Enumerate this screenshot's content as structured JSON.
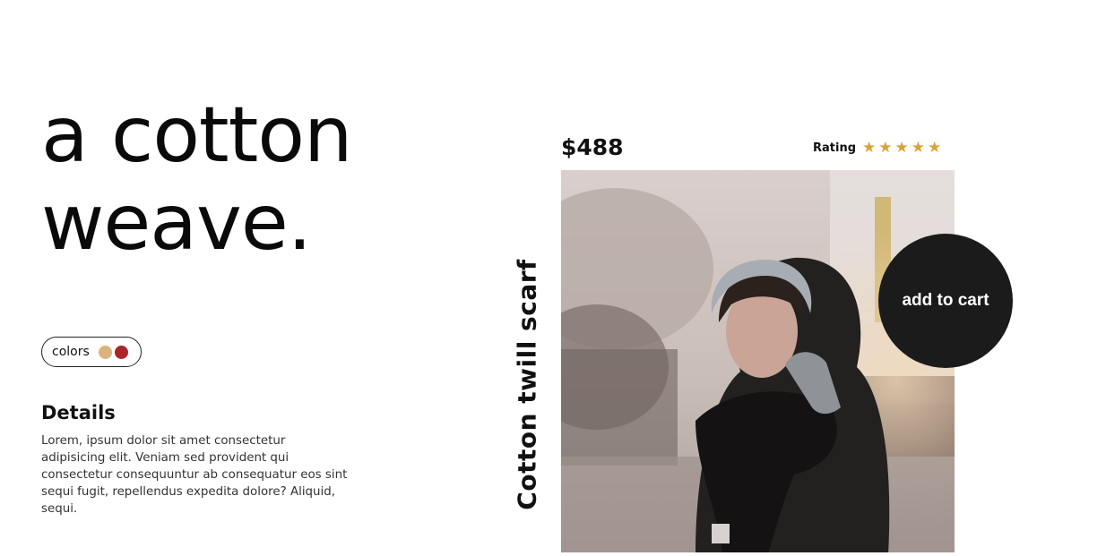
{
  "hero": {
    "line1": "a cotton",
    "line2": "weave."
  },
  "colors": {
    "label": "colors",
    "swatches": [
      {
        "name": "tan",
        "color": "#dcb27f"
      },
      {
        "name": "red",
        "color": "#a8262c"
      }
    ]
  },
  "details": {
    "title": "Details",
    "text": "Lorem, ipsum dolor sit amet consectetur adipisicing elit. Veniam sed provident qui consectetur consequuntur ab consequatur eos sint sequi fugit, repellendus expedita dolore? Aliquid, sequi."
  },
  "product": {
    "name": "Cotton twill scarf",
    "price": "$488",
    "rating_label": "Rating",
    "rating_stars": 5,
    "star_color": "#d6a43b",
    "photo_icon": "product-photo"
  },
  "cart": {
    "label": "add to cart"
  }
}
